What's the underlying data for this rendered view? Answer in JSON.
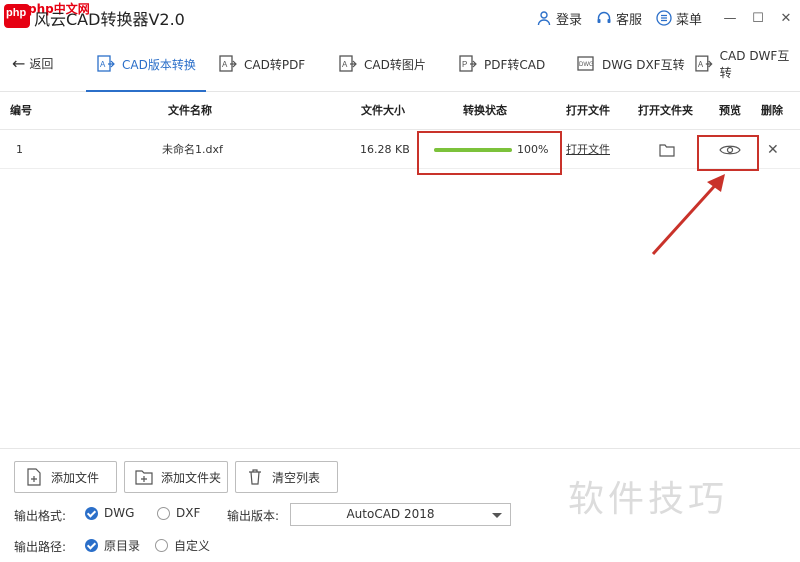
{
  "window": {
    "watermark": "php中文网",
    "title": "风云CAD转换器V2.0",
    "login": "登录",
    "service": "客服",
    "menu": "菜单"
  },
  "nav": {
    "back": "返回",
    "tabs": [
      {
        "label": "CAD版本转换",
        "active": true
      },
      {
        "label": "CAD转PDF"
      },
      {
        "label": "CAD转图片"
      },
      {
        "label": "PDF转CAD"
      },
      {
        "label": "DWG DXF互转"
      },
      {
        "label": "CAD DWF互转"
      }
    ]
  },
  "table": {
    "columns": [
      "编号",
      "文件名称",
      "文件大小",
      "转换状态",
      "打开文件",
      "打开文件夹",
      "预览",
      "删除"
    ],
    "rows": [
      {
        "index": "1",
        "name": "未命名1.dxf",
        "size": "16.28 KB",
        "progress": 100,
        "progress_label": "100%",
        "open_file": "打开文件"
      }
    ]
  },
  "bottom": {
    "add_file": "添加文件",
    "add_folder": "添加文件夹",
    "clear_list": "清空列表",
    "format_label": "输出格式:",
    "format_options": [
      "DWG",
      "DXF"
    ],
    "format_selected": "DWG",
    "version_label": "输出版本:",
    "version_value": "AutoCAD 2018",
    "path_label": "输出路径:",
    "path_options": [
      "原目录",
      "自定义"
    ],
    "path_selected": "原目录"
  },
  "watermark_bottom": "软件技巧",
  "colors": {
    "accent": "#2b6fc9",
    "progress": "#7cc23b",
    "annotation": "#c9322a"
  }
}
